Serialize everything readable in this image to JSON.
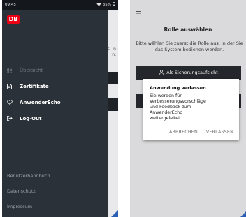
{
  "left": {
    "statusbar": {
      "time": "09:45",
      "right": "35%"
    },
    "logo": "DB",
    "menu": [
      {
        "icon": "grid-icon",
        "label": "Übersicht",
        "state": "disabled"
      },
      {
        "icon": "certificate-icon",
        "label": "Zertifikate",
        "state": "active"
      },
      {
        "icon": "heart-icon",
        "label": "AnwenderEcho",
        "state": "active"
      },
      {
        "icon": "logout-icon",
        "label": "Log-Out",
        "state": "active"
      }
    ],
    "footer": [
      "Benutzerhandbuch",
      "Datenschutz",
      "Impressum"
    ],
    "background_text": "s, in\nn."
  },
  "right": {
    "title": "Rolle auswählen",
    "description": "Bitte wählen Sie zuerst die Rolle aus, in der Sie das System bedienen werden.",
    "role_button": "Als Sicherungsaufsicht",
    "dialog": {
      "title": "Anwendung verlassen",
      "text": "Sie werden für Verbesserungsvorschläge und Feedback zum AnwenderEcho weitergeleitet.",
      "cancel": "ABBRECHEN",
      "confirm": "VERLASSEN"
    }
  },
  "colors": {
    "brand_red": "#ec0016",
    "drawer": "#2b3138",
    "button_dark": "#272b30",
    "accent_blue": "#2a5fb4"
  }
}
